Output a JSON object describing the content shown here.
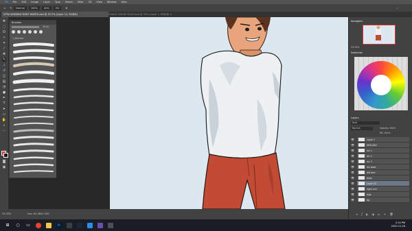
{
  "menubar": {
    "items": [
      "Ps",
      "File",
      "Edit",
      "Image",
      "Layer",
      "Type",
      "Select",
      "Filter",
      "3D",
      "View",
      "Window",
      "Help"
    ]
  },
  "options_bar": {
    "mode": "Normal",
    "opacity": "100%",
    "flow": "40%",
    "smoothing": "0%"
  },
  "doc_tabs": {
    "active": "XTRA WHINING PAINT WARTH.psd @ 33.3% (Layer 12, RGB/8)",
    "inactive": "CHAOS VISION TEL03.psd @ 50% (Layer 1, RGB/8) ×"
  },
  "brushes_panel": {
    "title": "Brushes",
    "size": "10 px",
    "group": "1_Brushes"
  },
  "navigator": {
    "title": "Navigator",
    "zoom": "33.33%"
  },
  "swatches": {
    "title": "Swatches"
  },
  "layers_panel": {
    "title": "Layers",
    "kind": "Kind",
    "blend": "Normal",
    "opacity": "Opacity: 100%",
    "fill": "Fill: 100%",
    "layers": [
      {
        "name": "Layer 1",
        "selected": false
      },
      {
        "name": "DEFLASH",
        "selected": false
      },
      {
        "name": "mc 1",
        "selected": false
      },
      {
        "name": "mc 2",
        "selected": false
      },
      {
        "name": "mc 3",
        "selected": false
      },
      {
        "name": "mc base",
        "selected": false
      },
      {
        "name": "left arm",
        "selected": false
      },
      {
        "name": "body",
        "selected": false
      },
      {
        "name": "Layer 12",
        "selected": true
      },
      {
        "name": "right arm",
        "selected": false
      },
      {
        "name": "legs",
        "selected": false
      },
      {
        "name": "bg",
        "selected": false
      }
    ]
  },
  "status": {
    "zoom": "33.33%",
    "doc": "Doc: 82.4M/1.34G"
  },
  "taskbar": {
    "time": "2:14 PM",
    "date": "2020-11-18"
  },
  "colors": {
    "accent": "#2d8ceb",
    "panel": "#535353",
    "canvas": "#dde7ef"
  }
}
